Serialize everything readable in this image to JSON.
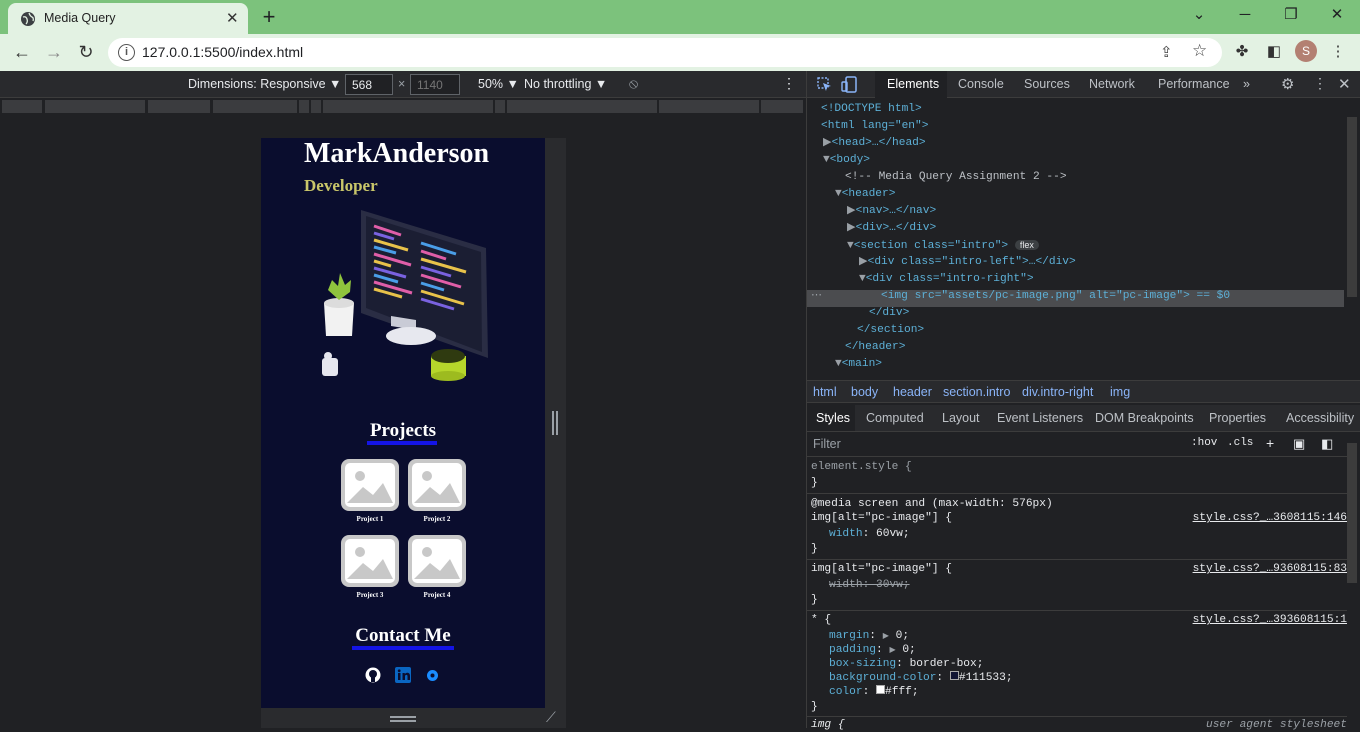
{
  "browser": {
    "tab_title": "Media Query",
    "url": "127.0.0.1:5500/index.html",
    "avatar_letter": "S"
  },
  "device_toolbar": {
    "dimensions": "Dimensions: Responsive",
    "width_value": "568",
    "height_placeholder": "1140",
    "times": "×",
    "zoom": "50%",
    "throttling": "No throttling"
  },
  "site": {
    "name": "MarkAnderson",
    "role": "Developer",
    "projects_title": "Projects",
    "projects": [
      "Project 1",
      "Project 2",
      "Project 3",
      "Project 4"
    ],
    "contact_title": "Contact Me"
  },
  "devtools": {
    "tabs": [
      "Elements",
      "Console",
      "Sources",
      "Network",
      "Performance"
    ],
    "dom_lines": [
      "<!DOCTYPE html>",
      "<html lang=\"en\">",
      "<head>…</head>",
      "<body>",
      "<!-- Media Query Assignment 2 -->",
      "<header>",
      "<nav>…</nav>",
      "<div>…</div>",
      "<section class=\"intro\">",
      "<div class=\"intro-left\">…</div>",
      "<div class=\"intro-right\">",
      "<img src=\"assets/pc-image.png\" alt=\"pc-image\"> == $0",
      "</div>",
      "</section>",
      "</header>",
      "<main>"
    ],
    "flex_badge": "flex",
    "breadcrumbs": [
      "html",
      "body",
      "header",
      "section.intro",
      "div.intro-right",
      "img"
    ],
    "subtabs": [
      "Styles",
      "Computed",
      "Layout",
      "Event Listeners",
      "DOM Breakpoints",
      "Properties",
      "Accessibility"
    ],
    "filter_placeholder": "Filter",
    "hov": ":hov",
    "cls": ".cls",
    "styles": {
      "element_style": "element.style {",
      "close": "}",
      "media": "@media screen and (max-width: 576px)",
      "rule1_selector": "img[alt=\"pc-image\"] {",
      "rule1_src": "style.css?_…3608115:146",
      "rule1_prop": "width",
      "rule1_val": "60vw;",
      "rule2_selector": "img[alt=\"pc-image\"] {",
      "rule2_src": "style.css?_…93608115:83",
      "rule2_prop": "width: 30vw;",
      "rule3_selector": "* {",
      "rule3_src": "style.css?_…393608115:1",
      "margin": "margin",
      "margin_val": "0;",
      "padding": "padding",
      "padding_val": "0;",
      "boxsizing": "box-sizing",
      "boxsizing_val": "border-box;",
      "bg": "background-color",
      "bg_val": "#111533;",
      "color": "color",
      "color_val": "#fff;",
      "rule4_selector": "img {",
      "rule4_src": "user agent stylesheet"
    }
  },
  "colors": {
    "accent": "#1414e6",
    "page_bg": "#0a0d2e",
    "role": "#c9c66a"
  }
}
